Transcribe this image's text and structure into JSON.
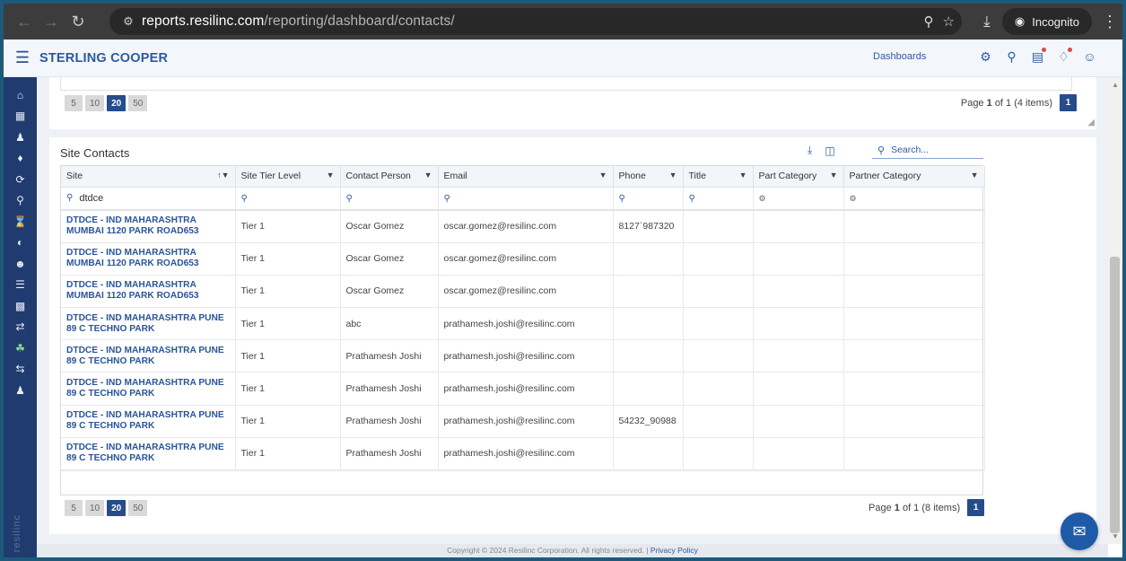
{
  "browser": {
    "url_host": "reports.resilinc.com",
    "url_path": "/reporting/dashboard/contacts/",
    "profile_label": "Incognito"
  },
  "app": {
    "brand": "STERLING COOPER",
    "dashboards_link": "Dashboards"
  },
  "top_card": {
    "page_sizes": [
      "5",
      "10",
      "20",
      "50"
    ],
    "active_page_size": "20",
    "page_info_prefix": "Page",
    "page_info_current": "1",
    "page_info_suffix": "of 1 (4 items)",
    "page_button": "1"
  },
  "site_contacts": {
    "title": "Site Contacts",
    "search_placeholder": "Search...",
    "columns": [
      "Site",
      "Site Tier Level",
      "Contact Person",
      "Email",
      "Phone",
      "Title",
      "Part Category",
      "Partner Category"
    ],
    "site_filter_value": "dtdce",
    "rows": [
      {
        "site": "DTDCE - IND MAHARASHTRA MUMBAI 1120 PARK ROAD653",
        "tier": "Tier 1",
        "contact": "Oscar Gomez",
        "email": "oscar.gomez@resilinc.com",
        "phone": "8127`987320",
        "title": "",
        "part": "",
        "partner": ""
      },
      {
        "site": "DTDCE - IND MAHARASHTRA MUMBAI 1120 PARK ROAD653",
        "tier": "Tier 1",
        "contact": "Oscar Gomez",
        "email": "oscar.gomez@resilinc.com",
        "phone": "",
        "title": "",
        "part": "",
        "partner": ""
      },
      {
        "site": "DTDCE - IND MAHARASHTRA MUMBAI 1120 PARK ROAD653",
        "tier": "Tier 1",
        "contact": "Oscar Gomez",
        "email": "oscar.gomez@resilinc.com",
        "phone": "",
        "title": "",
        "part": "",
        "partner": ""
      },
      {
        "site": "DTDCE - IND MAHARASHTRA PUNE 89 C TECHNO PARK",
        "tier": "Tier 1",
        "contact": "abc",
        "email": "prathamesh.joshi@resilinc.com",
        "phone": "",
        "title": "",
        "part": "",
        "partner": ""
      },
      {
        "site": "DTDCE - IND MAHARASHTRA PUNE 89 C TECHNO PARK",
        "tier": "Tier 1",
        "contact": "Prathamesh Joshi",
        "email": "prathamesh.joshi@resilinc.com",
        "phone": "",
        "title": "",
        "part": "",
        "partner": ""
      },
      {
        "site": "DTDCE - IND MAHARASHTRA PUNE 89 C TECHNO PARK",
        "tier": "Tier 1",
        "contact": "Prathamesh Joshi",
        "email": "prathamesh.joshi@resilinc.com",
        "phone": "",
        "title": "",
        "part": "",
        "partner": ""
      },
      {
        "site": "DTDCE - IND MAHARASHTRA PUNE 89 C TECHNO PARK",
        "tier": "Tier 1",
        "contact": "Prathamesh Joshi",
        "email": "prathamesh.joshi@resilinc.com",
        "phone": "54232_90988",
        "title": "",
        "part": "",
        "partner": ""
      },
      {
        "site": "DTDCE - IND MAHARASHTRA PUNE 89 C TECHNO PARK",
        "tier": "Tier 1",
        "contact": "Prathamesh Joshi",
        "email": "prathamesh.joshi@resilinc.com",
        "phone": "",
        "title": "",
        "part": "",
        "partner": ""
      }
    ],
    "page_sizes": [
      "5",
      "10",
      "20",
      "50"
    ],
    "active_page_size": "20",
    "page_info_prefix": "Page",
    "page_info_current": "1",
    "page_info_suffix": "of 1 (8 items)",
    "page_button": "1"
  },
  "footer": {
    "copyright": "Copyright © 2024 Resilinc Corporation. All rights reserved. |",
    "privacy": "Privacy Policy"
  },
  "sidebar_watermark": "resilinc",
  "colors": {
    "brand_blue": "#2c5aa0",
    "sidebar_bg": "#1f3b6f",
    "active_page": "#264c8c"
  }
}
